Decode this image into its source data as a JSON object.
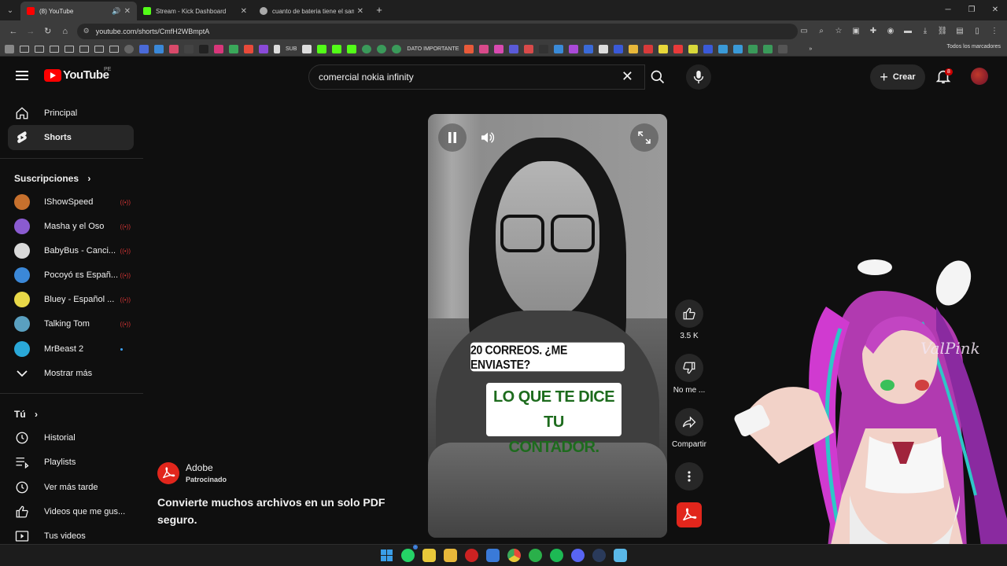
{
  "browser": {
    "tabs": [
      {
        "title": "(8) YouTube",
        "active": true,
        "color": "#ff0000",
        "audio": true
      },
      {
        "title": "Stream - Kick Dashboard",
        "active": false,
        "color": "#53fc18"
      },
      {
        "title": "cuanto de bateria tiene el samsu",
        "active": false,
        "color": "#aaaaaa"
      }
    ],
    "url": "youtube.com/shorts/CmfH2WBmptA",
    "bookmarks": {
      "sub_label": "SUB",
      "important_label": "DATO IMPORTANTE",
      "all_label": "Todos los marcadores"
    }
  },
  "header": {
    "logo_text": "YouTube",
    "country_code": "PE",
    "search_value": "comercial nokia infinity",
    "create_label": "Crear",
    "notification_count": "8"
  },
  "sidebar": {
    "main": [
      {
        "label": "Principal",
        "icon": "home-icon"
      },
      {
        "label": "Shorts",
        "icon": "shorts-icon",
        "active": true
      }
    ],
    "subscriptions_title": "Suscripciones",
    "subscriptions": [
      {
        "label": "IShowSpeed",
        "status": "live",
        "color": "#c6702d"
      },
      {
        "label": "Masha y el Oso",
        "status": "live",
        "color": "#8a5bd0"
      },
      {
        "label": "BabyBus - Canci...",
        "status": "live",
        "color": "#d9d9d9"
      },
      {
        "label": "Pocoyó ᴇs Españ...",
        "status": "live",
        "color": "#3b88d8"
      },
      {
        "label": "Bluey - Español ...",
        "status": "live",
        "color": "#e8d848"
      },
      {
        "label": "Talking Tom",
        "status": "live",
        "color": "#5aa0c0"
      },
      {
        "label": "MrBeast 2",
        "status": "new",
        "color": "#2aa8d8"
      }
    ],
    "show_more": "Mostrar más",
    "you_title": "Tú",
    "you_items": [
      {
        "label": "Historial",
        "icon": "history-icon"
      },
      {
        "label": "Playlists",
        "icon": "playlist-icon"
      },
      {
        "label": "Ver más tarde",
        "icon": "clock-icon"
      },
      {
        "label": "Videos que me gus...",
        "icon": "like-icon"
      },
      {
        "label": "Tus videos",
        "icon": "video-icon"
      }
    ]
  },
  "ad": {
    "advertiser": "Adobe",
    "sponsored": "Patrocinado",
    "headline": "Convierte muchos archivos en un solo PDF seguro."
  },
  "video": {
    "caption_top": "20 CORREOS. ¿ME ENVIASTE?",
    "caption_main_line1": "LO QUE TE DICE TU",
    "caption_main_line2": "CONTADOR."
  },
  "actions": {
    "like_count": "3.5 K",
    "dislike_label": "No me ...",
    "share_label": "Compartir"
  },
  "overlay": {
    "watermark": "ValPink"
  },
  "colors": {
    "brand_red": "#ff0000",
    "background": "#0f0f0f",
    "live_red": "#cc3333",
    "caption_green": "#1d6b1d"
  }
}
